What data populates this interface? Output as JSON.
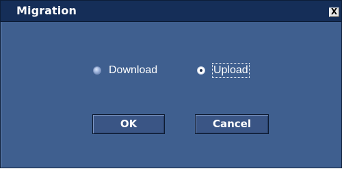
{
  "dialog": {
    "title": "Migration",
    "close_label": "X"
  },
  "options": {
    "download_label": "Download",
    "upload_label": "Upload",
    "selected": "Upload"
  },
  "buttons": {
    "ok_label": "OK",
    "cancel_label": "Cancel"
  },
  "colors": {
    "dialog_background": "#3f5f8f",
    "titlebar_background": "#152e58",
    "text": "#ffffff"
  }
}
